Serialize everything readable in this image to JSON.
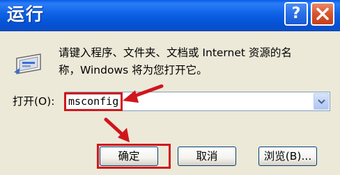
{
  "window": {
    "title": "运行",
    "help_glyph": "?",
    "description_line1": "请键入程序、文件夹、文档或 Internet 资源的名",
    "description_line2": "称，Windows 将为您打开它。"
  },
  "open_field": {
    "label": "打开(O):",
    "value": "msconfig"
  },
  "buttons": {
    "ok": "确定",
    "cancel": "取消",
    "browse": "浏览(B)..."
  },
  "colors": {
    "titlebar": "#0553d6",
    "annotation": "#d0161d",
    "dialog_bg": "#ece9d8"
  }
}
